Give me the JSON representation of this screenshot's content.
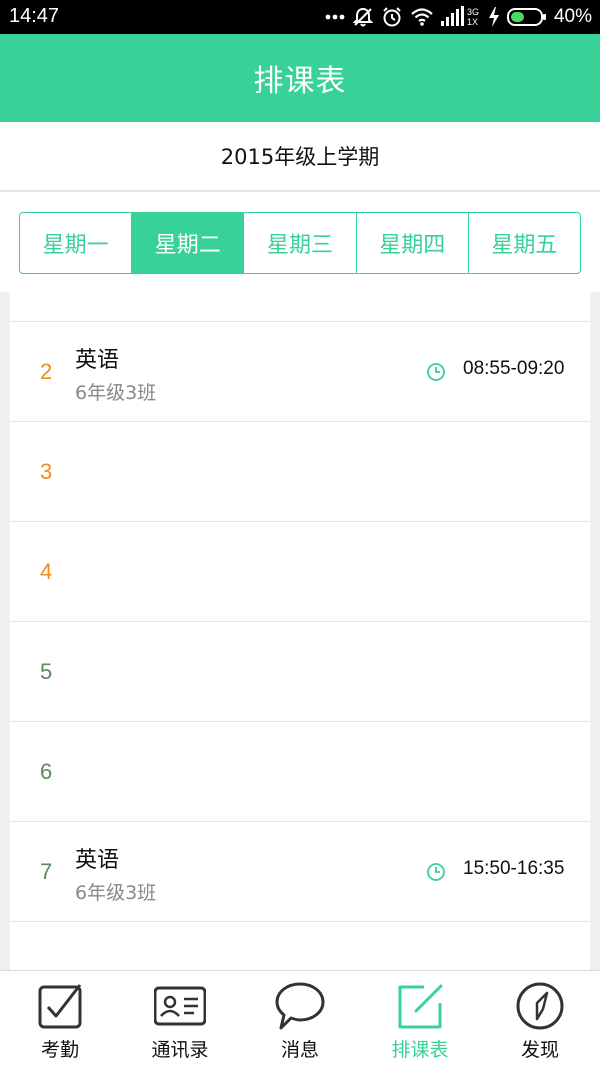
{
  "status_bar": {
    "time": "14:47",
    "battery_text": "40%",
    "network_3g": "3G",
    "network_1x": "1X",
    "icons": [
      "more-dots-icon",
      "silent-icon",
      "alarm-icon",
      "wifi-icon",
      "signal-icon",
      "charging-icon",
      "battery-icon"
    ]
  },
  "header": {
    "title": "排课表"
  },
  "term": {
    "label": "2015年级上学期"
  },
  "day_tabs": [
    {
      "label": "星期一",
      "active": false
    },
    {
      "label": "星期二",
      "active": true
    },
    {
      "label": "星期三",
      "active": false
    },
    {
      "label": "星期四",
      "active": false
    },
    {
      "label": "星期五",
      "active": false
    }
  ],
  "schedule": [
    {
      "index": "2",
      "course": "英语",
      "class": "6年级3班",
      "time": "08:55-09:20"
    },
    {
      "index": "3",
      "course": "",
      "class": "",
      "time": ""
    },
    {
      "index": "4",
      "course": "",
      "class": "",
      "time": ""
    },
    {
      "index": "5",
      "course": "",
      "class": "",
      "time": ""
    },
    {
      "index": "6",
      "course": "",
      "class": "",
      "time": ""
    },
    {
      "index": "7",
      "course": "英语",
      "class": "6年级3班",
      "time": "15:50-16:35"
    }
  ],
  "colors": {
    "accent": "#38d197",
    "index_orange": "#f08c1c",
    "index_green": "#5c8a5c"
  },
  "bottom_nav": [
    {
      "label": "考勤",
      "icon": "checkbox-icon",
      "active": false
    },
    {
      "label": "通讯录",
      "icon": "contact-card-icon",
      "active": false
    },
    {
      "label": "消息",
      "icon": "chat-bubble-icon",
      "active": false
    },
    {
      "label": "排课表",
      "icon": "edit-schedule-icon",
      "active": true
    },
    {
      "label": "发现",
      "icon": "compass-icon",
      "active": false
    }
  ]
}
